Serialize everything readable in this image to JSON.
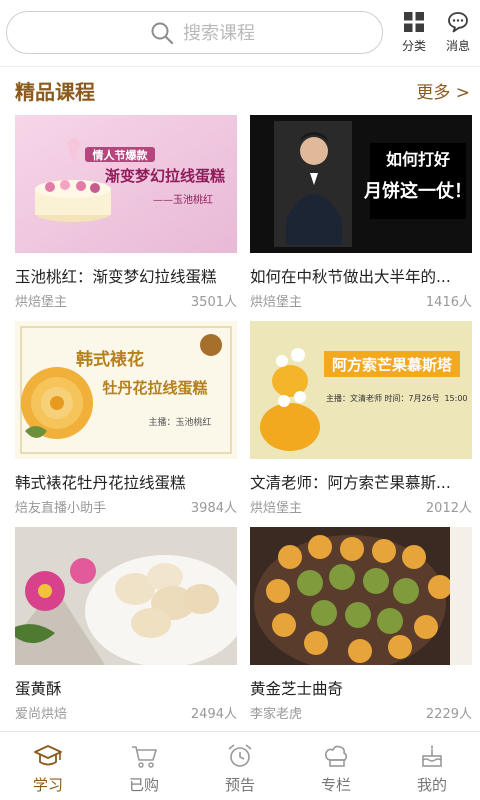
{
  "search": {
    "placeholder": "搜索课程"
  },
  "top_buttons": {
    "category": "分类",
    "messages": "消息"
  },
  "section": {
    "title": "精品课程",
    "more": "更多 >"
  },
  "courses": [
    {
      "title": "玉池桃红：渐变梦幻拉线蛋糕",
      "author": "烘焙堡主",
      "count": "3501人",
      "thumb_text": [
        "情人节爆款",
        "渐变梦幻拉线蛋糕",
        "——玉池桃红"
      ]
    },
    {
      "title": "如何在中秋节做出大半年的...",
      "author": "烘焙堡主",
      "count": "1416人",
      "thumb_text": [
        "如何打好",
        "月饼这一仗！"
      ]
    },
    {
      "title": "韩式裱花牡丹花拉线蛋糕",
      "author": "焙友直播小助手",
      "count": "3984人",
      "thumb_text": [
        "韩式裱花",
        "牡丹花拉线蛋糕",
        "主播：玉池桃红"
      ]
    },
    {
      "title": "文清老师：阿方索芒果慕斯...",
      "author": "烘焙堡主",
      "count": "2012人",
      "thumb_text": [
        "阿方索芒果慕斯塔",
        "主播：文清老师",
        "时间：7月26号",
        "15:00"
      ]
    },
    {
      "title": "蛋黄酥",
      "author": "爱尚烘焙",
      "count": "2494人",
      "thumb_text": []
    },
    {
      "title": "黄金芝士曲奇",
      "author": "李家老虎",
      "count": "2229人",
      "thumb_text": []
    }
  ],
  "nav": [
    {
      "label": "学习",
      "icon": "graduation-cap-icon",
      "active": true
    },
    {
      "label": "已购",
      "icon": "cart-icon",
      "active": false
    },
    {
      "label": "预告",
      "icon": "alarm-clock-icon",
      "active": false
    },
    {
      "label": "专栏",
      "icon": "chef-hat-icon",
      "active": false
    },
    {
      "label": "我的",
      "icon": "cake-icon",
      "active": false
    }
  ],
  "colors": {
    "accent": "#8a5a1e",
    "muted": "#999999"
  }
}
